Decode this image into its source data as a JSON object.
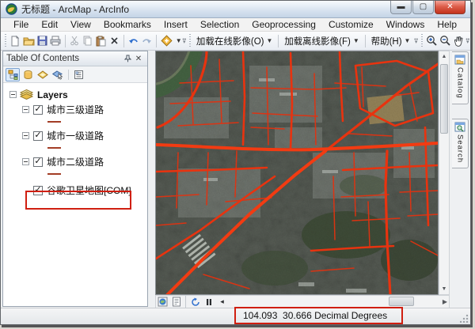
{
  "window": {
    "title": "无标题 - ArcMap - ArcInfo"
  },
  "menu": {
    "items": [
      "File",
      "Edit",
      "View",
      "Bookmarks",
      "Insert",
      "Selection",
      "Geoprocessing",
      "Customize",
      "Windows",
      "Help"
    ]
  },
  "toolbar": {
    "load_online_label": "加载在线影像(O)",
    "load_offline_label": "加载离线影像(F)",
    "help_label": "帮助(H)"
  },
  "toc": {
    "title": "Table Of Contents",
    "root_label": "Layers",
    "layers": [
      {
        "label": "城市三级道路",
        "checked": true
      },
      {
        "label": "城市一级道路",
        "checked": true
      },
      {
        "label": "城市二级道路",
        "checked": true
      },
      {
        "label": "谷歌卫星地图[COM]",
        "checked": true,
        "highlighted": true
      }
    ]
  },
  "side_tabs": {
    "catalog": "Catalog",
    "search": "Search"
  },
  "status": {
    "coordinates": "104.093  30.666 Decimal Degrees"
  },
  "colors": {
    "road": "#e8330f",
    "annotation": "#d01f10"
  }
}
